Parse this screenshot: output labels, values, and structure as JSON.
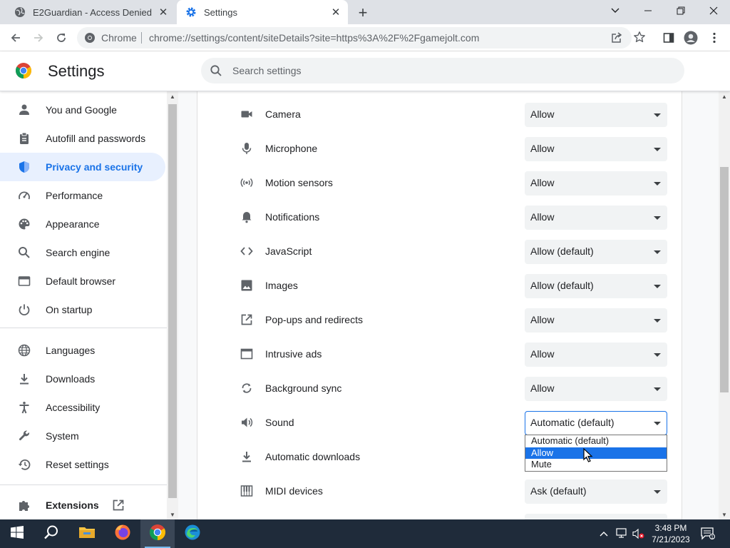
{
  "tabs": [
    {
      "title": "E2Guardian - Access Denied",
      "icon": "globe-icon"
    },
    {
      "title": "Settings",
      "icon": "gear-icon"
    }
  ],
  "omnibox": {
    "site_label": "Chrome",
    "url": "chrome://settings/content/siteDetails?site=https%3A%2F%2Fgamejolt.com"
  },
  "settings": {
    "title": "Settings",
    "search_placeholder": "Search settings"
  },
  "sidebar": {
    "items": [
      {
        "label": "You and Google",
        "icon": "person-icon"
      },
      {
        "label": "Autofill and passwords",
        "icon": "clipboard-icon"
      },
      {
        "label": "Privacy and security",
        "icon": "shield-icon"
      },
      {
        "label": "Performance",
        "icon": "speedometer-icon"
      },
      {
        "label": "Appearance",
        "icon": "palette-icon"
      },
      {
        "label": "Search engine",
        "icon": "search-icon"
      },
      {
        "label": "Default browser",
        "icon": "browser-icon"
      },
      {
        "label": "On startup",
        "icon": "power-icon"
      },
      {
        "label": "Languages",
        "icon": "globe-icon"
      },
      {
        "label": "Downloads",
        "icon": "download-icon"
      },
      {
        "label": "Accessibility",
        "icon": "accessibility-icon"
      },
      {
        "label": "System",
        "icon": "wrench-icon"
      },
      {
        "label": "Reset settings",
        "icon": "restore-icon"
      },
      {
        "label": "Extensions",
        "icon": "puzzle-icon"
      }
    ]
  },
  "permissions": [
    {
      "label": "Camera",
      "value": "Allow",
      "icon": "camera-icon"
    },
    {
      "label": "Microphone",
      "value": "Allow",
      "icon": "microphone-icon"
    },
    {
      "label": "Motion sensors",
      "value": "Allow",
      "icon": "motion-sensor-icon"
    },
    {
      "label": "Notifications",
      "value": "Allow",
      "icon": "bell-icon"
    },
    {
      "label": "JavaScript",
      "value": "Allow (default)",
      "icon": "code-icon"
    },
    {
      "label": "Images",
      "value": "Allow (default)",
      "icon": "image-icon"
    },
    {
      "label": "Pop-ups and redirects",
      "value": "Allow",
      "icon": "open-in-new-icon"
    },
    {
      "label": "Intrusive ads",
      "value": "Allow",
      "icon": "window-icon"
    },
    {
      "label": "Background sync",
      "value": "Allow",
      "icon": "sync-icon"
    },
    {
      "label": "Sound",
      "value": "Automatic (default)",
      "icon": "speaker-icon"
    },
    {
      "label": "Automatic downloads",
      "value": "",
      "icon": "download-icon"
    },
    {
      "label": "MIDI devices",
      "value": "Ask (default)",
      "icon": "piano-icon"
    }
  ],
  "dropdown": {
    "options": [
      "Automatic (default)",
      "Allow",
      "Mute"
    ],
    "highlighted": "Allow"
  },
  "taskbar": {
    "time": "3:48 PM",
    "date": "7/21/2023"
  },
  "colors": {
    "accent": "#1a73e8",
    "taskbar": "#1f2b3a",
    "tabstrip": "#dee1e6"
  }
}
